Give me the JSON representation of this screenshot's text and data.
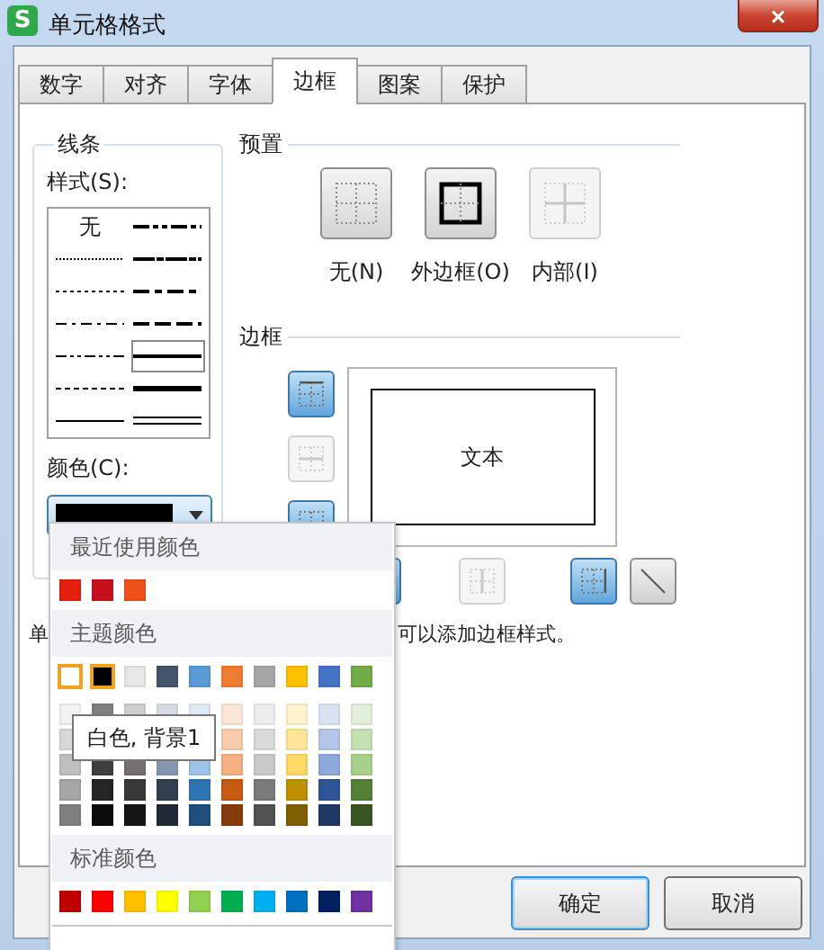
{
  "window": {
    "app_icon": "S",
    "title": "单元格格式",
    "close": "×"
  },
  "tabs": [
    {
      "label": "数字",
      "selected": false
    },
    {
      "label": "对齐",
      "selected": false
    },
    {
      "label": "字体",
      "selected": false
    },
    {
      "label": "边框",
      "selected": true
    },
    {
      "label": "图案",
      "selected": false
    },
    {
      "label": "保护",
      "selected": false
    }
  ],
  "line_group": {
    "title": "线条",
    "style_label": "样式(S):",
    "styles": [
      {
        "kind": "none",
        "label": "无",
        "selected": false
      },
      {
        "kind": "medium_dash_dot_dot",
        "selected": false
      },
      {
        "kind": "hair",
        "selected": false
      },
      {
        "kind": "slant_dash_dot",
        "selected": false
      },
      {
        "kind": "dotted",
        "selected": false
      },
      {
        "kind": "medium_dash_dot",
        "selected": false
      },
      {
        "kind": "dash_dot",
        "selected": false
      },
      {
        "kind": "medium_dashed",
        "selected": false
      },
      {
        "kind": "dash_dot_dot",
        "selected": false
      },
      {
        "kind": "medium",
        "selected": true
      },
      {
        "kind": "dashed",
        "selected": false
      },
      {
        "kind": "thick",
        "selected": false
      },
      {
        "kind": "thin",
        "selected": false
      },
      {
        "kind": "double",
        "selected": false
      }
    ],
    "color_label": "颜色(C):",
    "color": "#000000"
  },
  "presets": {
    "title": "预置",
    "items": [
      {
        "kind": "none",
        "label": "无(N)",
        "disabled": false
      },
      {
        "kind": "outline",
        "label": "外边框(O)",
        "disabled": false
      },
      {
        "kind": "inside",
        "label": "内部(I)",
        "disabled": true
      }
    ]
  },
  "border": {
    "title": "边框",
    "preview_text": "文本",
    "side_buttons": [
      {
        "kind": "top",
        "on": true,
        "disabled": false
      },
      {
        "kind": "middle_h",
        "on": false,
        "disabled": true
      },
      {
        "kind": "bottom",
        "on": true,
        "disabled": false
      }
    ],
    "bottom_buttons": [
      {
        "kind": "left",
        "on": true,
        "disabled": false
      },
      {
        "kind": "middle_v",
        "on": false,
        "disabled": true
      },
      {
        "kind": "right",
        "on": true,
        "disabled": false
      },
      {
        "kind": "diagonal",
        "on": false,
        "disabled": false
      }
    ]
  },
  "hint": [
    "单",
    "可以添加边框样式。"
  ],
  "buttons": [
    {
      "label": "确定",
      "default": true
    },
    {
      "label": "取消",
      "default": false
    }
  ],
  "color_menu": {
    "tooltip": "白色, 背景1",
    "sections": [
      {
        "title": "最近使用颜色",
        "rows": [
          {
            "swatches": [
              {
                "color": "#e5200f",
                "selected": false
              },
              {
                "color": "#c8101a",
                "selected": false
              },
              {
                "color": "#f0501a",
                "selected": false
              }
            ]
          }
        ]
      },
      {
        "title": "主题颜色",
        "rows": [
          {
            "swatches": [
              {
                "color": "#ffffff",
                "selected": true
              },
              {
                "color": "#000000",
                "selected": true
              },
              {
                "color": "#e7e6e6",
                "selected": false
              },
              {
                "color": "#44546a",
                "selected": false
              },
              {
                "color": "#5b9bd5",
                "selected": false
              },
              {
                "color": "#ed7d31",
                "selected": false
              },
              {
                "color": "#a5a5a5",
                "selected": false
              },
              {
                "color": "#ffc000",
                "selected": false
              },
              {
                "color": "#4472c4",
                "selected": false
              },
              {
                "color": "#70ad47",
                "selected": false
              }
            ]
          },
          {
            "swatches": [
              {
                "color": "#f2f2f2",
                "selected": false
              },
              {
                "color": "#7f7f7f",
                "selected": false
              },
              {
                "color": "#d0cece",
                "selected": false
              },
              {
                "color": "#d6dce4",
                "selected": false
              },
              {
                "color": "#deebf6",
                "selected": false
              },
              {
                "color": "#fbe5d5",
                "selected": false
              },
              {
                "color": "#ededed",
                "selected": false
              },
              {
                "color": "#fff2cc",
                "selected": false
              },
              {
                "color": "#dae3f3",
                "selected": false
              },
              {
                "color": "#e2efd9",
                "selected": false
              }
            ]
          },
          {
            "swatches": [
              {
                "color": "#d8d8d8",
                "selected": false
              }
            ],
            "swatches_right": [
              {
                "color": "#f7cbac",
                "selected": false
              },
              {
                "color": "#dbdbdb",
                "selected": false
              },
              {
                "color": "#fee599",
                "selected": false
              },
              {
                "color": "#b4c6e7",
                "selected": false
              },
              {
                "color": "#c5e0b3",
                "selected": false
              }
            ]
          },
          {
            "swatches": [
              {
                "color": "#bfbfbf",
                "selected": false
              },
              {
                "color": "#3f3f3f",
                "selected": false
              },
              {
                "color": "#757070",
                "selected": false
              },
              {
                "color": "#8496b0",
                "selected": false
              },
              {
                "color": "#9dc3e6",
                "selected": false
              },
              {
                "color": "#f4b183",
                "selected": false
              },
              {
                "color": "#c9c9c9",
                "selected": false
              },
              {
                "color": "#ffd965",
                "selected": false
              },
              {
                "color": "#8eaadb",
                "selected": false
              },
              {
                "color": "#a8d08d",
                "selected": false
              }
            ]
          },
          {
            "swatches": [
              {
                "color": "#a5a5a5",
                "selected": false
              },
              {
                "color": "#262626",
                "selected": false
              },
              {
                "color": "#3a3838",
                "selected": false
              },
              {
                "color": "#323f4f",
                "selected": false
              },
              {
                "color": "#2e75b5",
                "selected": false
              },
              {
                "color": "#c55a11",
                "selected": false
              },
              {
                "color": "#7b7b7b",
                "selected": false
              },
              {
                "color": "#bf9000",
                "selected": false
              },
              {
                "color": "#2f5496",
                "selected": false
              },
              {
                "color": "#538135",
                "selected": false
              }
            ]
          },
          {
            "swatches": [
              {
                "color": "#7f7f7f",
                "selected": false
              },
              {
                "color": "#0c0c0c",
                "selected": false
              },
              {
                "color": "#171616",
                "selected": false
              },
              {
                "color": "#222a35",
                "selected": false
              },
              {
                "color": "#1e4e79",
                "selected": false
              },
              {
                "color": "#833c0b",
                "selected": false
              },
              {
                "color": "#525252",
                "selected": false
              },
              {
                "color": "#7f6000",
                "selected": false
              },
              {
                "color": "#1f3864",
                "selected": false
              },
              {
                "color": "#375623",
                "selected": false
              }
            ]
          }
        ]
      },
      {
        "title": "标准颜色",
        "rows": [
          {
            "swatches": [
              {
                "color": "#c00000",
                "selected": false
              },
              {
                "color": "#ff0000",
                "selected": false
              },
              {
                "color": "#ffc000",
                "selected": false
              },
              {
                "color": "#ffff00",
                "selected": false
              },
              {
                "color": "#92d050",
                "selected": false
              },
              {
                "color": "#00b050",
                "selected": false
              },
              {
                "color": "#00b0f0",
                "selected": false
              },
              {
                "color": "#0070c0",
                "selected": false
              },
              {
                "color": "#002060",
                "selected": false
              },
              {
                "color": "#7030a0",
                "selected": false
              }
            ]
          }
        ]
      }
    ]
  }
}
